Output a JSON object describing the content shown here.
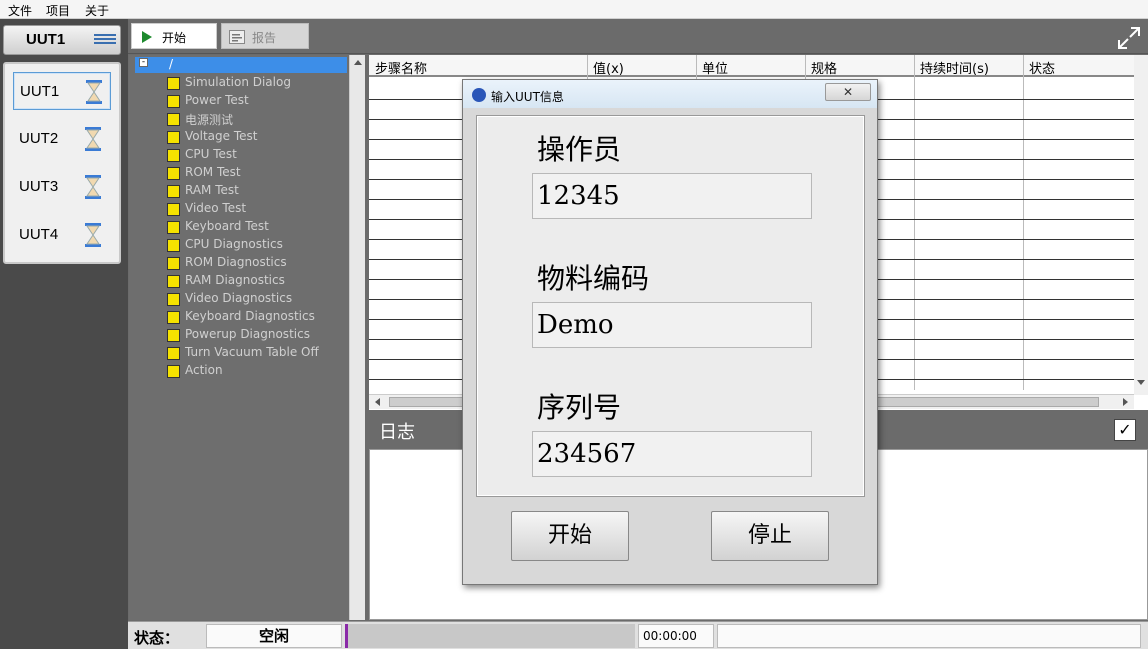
{
  "menu": {
    "items": [
      "文件",
      "项目",
      "关于"
    ]
  },
  "uut_panel": {
    "header": "UUT1",
    "items": [
      {
        "label": "UUT1"
      },
      {
        "label": "UUT2"
      },
      {
        "label": "UUT3"
      },
      {
        "label": "UUT4"
      }
    ]
  },
  "toolbar": {
    "tab_start": "开始",
    "tab_report": "报告"
  },
  "tree": {
    "root_label": "/",
    "items": [
      "Simulation Dialog",
      "Power Test",
      "电源测试",
      "Voltage Test",
      "CPU Test",
      "ROM Test",
      "RAM Test",
      "Video Test",
      "Keyboard Test",
      "CPU Diagnostics",
      "ROM Diagnostics",
      "RAM Diagnostics",
      "Video Diagnostics",
      "Keyboard Diagnostics",
      "Powerup Diagnostics",
      "Turn Vacuum Table Off",
      "Action"
    ]
  },
  "steps_table": {
    "columns": [
      "步骤名称",
      "值(x)",
      "单位",
      "规格",
      "持续时间(s)",
      "状态"
    ]
  },
  "log": {
    "title": "日志",
    "check_mark": "✓"
  },
  "status": {
    "label": "状态：",
    "value": "空闲",
    "time": "00:00:00"
  },
  "dialog": {
    "title": "输入UUT信息",
    "close": "✕",
    "operator_label": "操作员",
    "operator_value": "12345",
    "material_label": "物料编码",
    "material_value": "Demo",
    "serial_label": "序列号",
    "serial_value": "234567",
    "start_button": "开始",
    "stop_button": "停止"
  }
}
